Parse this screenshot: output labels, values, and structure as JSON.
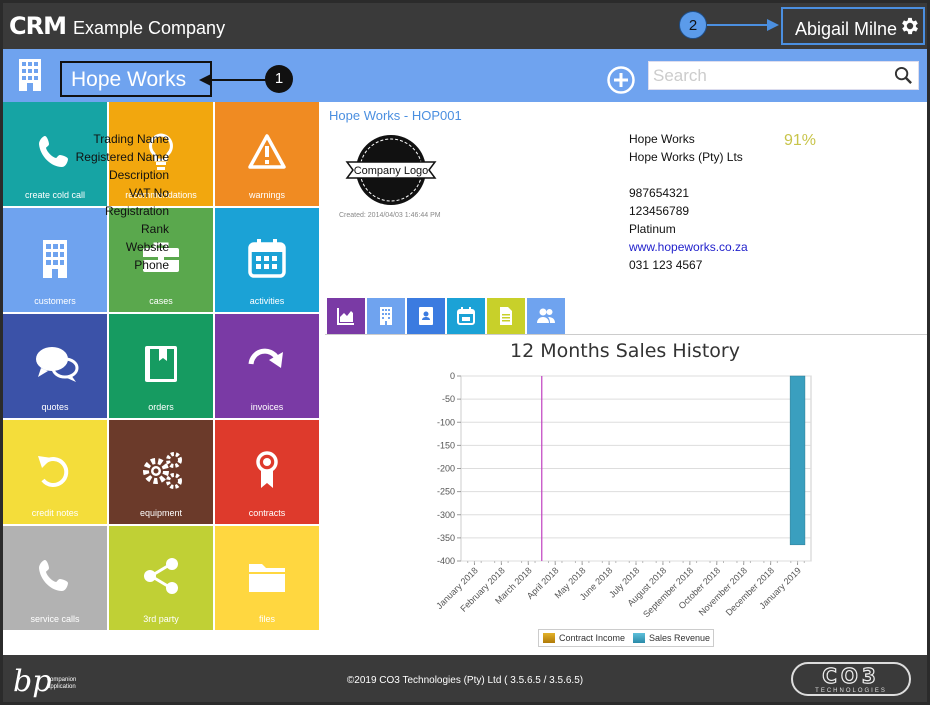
{
  "topbar": {
    "logo": "CRM",
    "company": "Example Company",
    "user": "Abigail Milne",
    "annotation": "2"
  },
  "header": {
    "title": "Hope Works",
    "annotation": "1",
    "search_placeholder": "Search"
  },
  "tiles": [
    {
      "label": "create cold call",
      "icon": "phone-icon",
      "color": "#16a4a4"
    },
    {
      "label": "recommendations",
      "icon": "lightbulb-icon",
      "color": "#f2a70e"
    },
    {
      "label": "warnings",
      "icon": "warning-icon",
      "color": "#f08b22"
    },
    {
      "label": "customers",
      "icon": "building-icon",
      "color": "#6fa3ef"
    },
    {
      "label": "cases",
      "icon": "briefcase-icon",
      "color": "#5aa84d"
    },
    {
      "label": "activities",
      "icon": "calendar-icon",
      "color": "#1ba2d6"
    },
    {
      "label": "quotes",
      "icon": "chat-icon",
      "color": "#3b52a8"
    },
    {
      "label": "orders",
      "icon": "book-icon",
      "color": "#169b61"
    },
    {
      "label": "invoices",
      "icon": "redo-icon",
      "color": "#7a3aa5"
    },
    {
      "label": "credit notes",
      "icon": "undo-icon",
      "color": "#f4dd3a"
    },
    {
      "label": "equipment",
      "icon": "gears-icon",
      "color": "#6b3a2a"
    },
    {
      "label": "contracts",
      "icon": "ribbon-icon",
      "color": "#de3a2c"
    },
    {
      "label": "service calls",
      "icon": "phone-icon",
      "color": "#b2b2b2"
    },
    {
      "label": "3rd party",
      "icon": "share-icon",
      "color": "#c0d035"
    },
    {
      "label": "files",
      "icon": "folder-icon",
      "color": "#ffd740"
    }
  ],
  "company": {
    "link": "Hope Works - HOP001",
    "logo_text": "Company Logo",
    "created": "Created: 2014/04/03 1:46:44 PM",
    "percent": "91%",
    "fields": [
      {
        "label": "Trading Name",
        "value": "Hope Works"
      },
      {
        "label": "Registered Name",
        "value": "Hope Works (Pty) Lts"
      },
      {
        "label": "Description",
        "value": ""
      },
      {
        "label": "VAT No",
        "value": "987654321"
      },
      {
        "label": "Registration",
        "value": "123456789"
      },
      {
        "label": "Rank",
        "value": "Platinum"
      },
      {
        "label": "Website",
        "value": "www.hopeworks.co.za",
        "link": true
      },
      {
        "label": "Phone",
        "value": "031 123 4567"
      }
    ]
  },
  "tabs": [
    {
      "icon": "area-chart-icon",
      "color": "#7a3aa5"
    },
    {
      "icon": "building-icon",
      "color": "#6fa3ef"
    },
    {
      "icon": "contacts-icon",
      "color": "#3b7be0"
    },
    {
      "icon": "calendar-icon",
      "color": "#1ba2d6"
    },
    {
      "icon": "document-icon",
      "color": "#c8d02a"
    },
    {
      "icon": "users-icon",
      "color": "#6fa3ef"
    }
  ],
  "chart_data": {
    "type": "bar",
    "title": "12 Months Sales History",
    "categories": [
      "January 2018",
      "February 2018",
      "March 2018",
      "April 2018",
      "May 2018",
      "June 2018",
      "July 2018",
      "August 2018",
      "September 2018",
      "October 2018",
      "November 2018",
      "December 2018",
      "January 2019"
    ],
    "series": [
      {
        "name": "Contract Income",
        "color": "#d49a0e",
        "values": [
          0,
          0,
          0,
          0,
          0,
          0,
          0,
          0,
          0,
          0,
          0,
          0,
          0
        ]
      },
      {
        "name": "Sales Revenue",
        "color": "#3a9fbf",
        "values": [
          0,
          0,
          0,
          0,
          0,
          0,
          0,
          0,
          0,
          0,
          0,
          0,
          -365
        ]
      }
    ],
    "yticks": [
      0,
      -50,
      -100,
      -150,
      -200,
      -250,
      -300,
      -350,
      -400
    ],
    "ylim": [
      -400,
      0
    ],
    "marker_line_category": "April 2018",
    "grid": true,
    "legend": "bottom"
  },
  "footer": {
    "copyright": "©2019 CO3 Technologies (Pty) Ltd ( 3.5.6.5 / 3.5.6.5)",
    "bp_logo_text": "companion application",
    "co3_logo_text": "CO3",
    "co3_tagline": "TECHNOLOGIES"
  }
}
